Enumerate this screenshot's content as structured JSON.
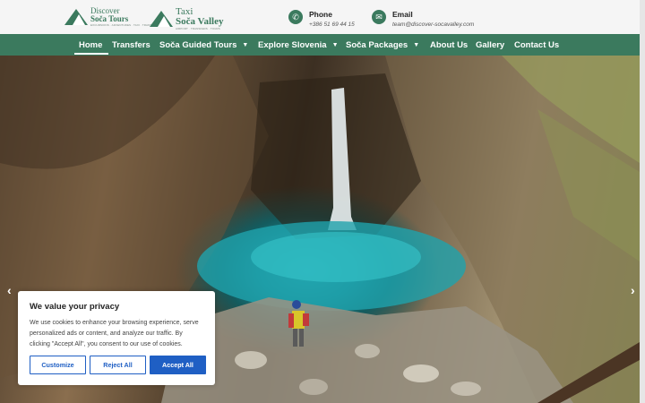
{
  "brand": {
    "logo1": {
      "line1": "Discover",
      "line2": "Soča Tours",
      "tagline": "EXCURSIONS · ADVENTURES · TAXI · TRANSFERS"
    },
    "logo2": {
      "line1": "Taxi",
      "line2": "Soča Valley",
      "tagline": "AIRPORT · TRANSFERS · TOURS"
    },
    "color": "#3b7a5e"
  },
  "contact": {
    "phone": {
      "title": "Phone",
      "value": "+386 51 69 44 15",
      "icon": "phone-icon"
    },
    "email": {
      "title": "Email",
      "value": "team@discover-socavalley.com",
      "icon": "mail-icon"
    }
  },
  "nav": {
    "items": [
      {
        "label": "Home",
        "active": true
      },
      {
        "label": "Transfers",
        "dropdown": false
      },
      {
        "label": "Soča Guided Tours",
        "dropdown": true
      },
      {
        "label": "Explore Slovenia",
        "dropdown": true
      },
      {
        "label": "Soča Packages",
        "dropdown": true
      },
      {
        "label": "About Us",
        "dropdown": false
      },
      {
        "label": "Gallery",
        "dropdown": false
      },
      {
        "label": "Contact Us",
        "dropdown": false
      }
    ],
    "caret": "▼"
  },
  "hero": {
    "prev_arrow": "‹",
    "next_arrow": "›",
    "image": "waterfall canyon with turquoise pool and hiker"
  },
  "cookie_banner": {
    "title": "We value your privacy",
    "text": "We use cookies to enhance your browsing experience, serve personalized ads or content, and analyze our traffic. By clicking \"Accept All\", you consent to our use of cookies.",
    "customize_label": "Customize",
    "reject_label": "Reject All",
    "accept_label": "Accept All"
  }
}
